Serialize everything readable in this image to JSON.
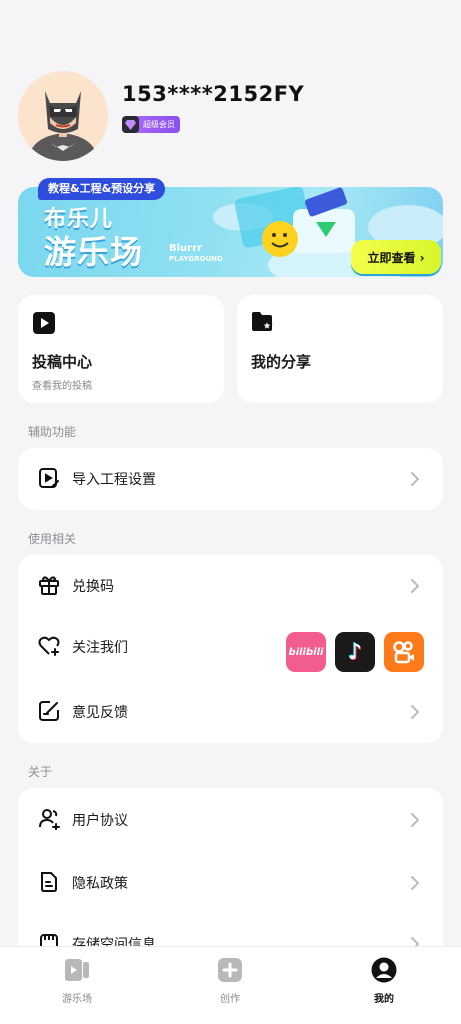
{
  "profile": {
    "username": "153****2152FY",
    "vip_label": "超级会员"
  },
  "banner": {
    "tag": "教程&工程&预设分享",
    "title_line1": "布乐儿",
    "title_line2": "游乐场",
    "brand_en": "Blurrr",
    "brand_sub": "PLAYGROUND",
    "cta": "立即查看 ›"
  },
  "tiles": {
    "submissions": {
      "title": "投稿中心",
      "subtitle": "查看我的投稿"
    },
    "shares": {
      "title": "我的分享"
    }
  },
  "sections": {
    "aux": "辅助功能",
    "usage": "使用相关",
    "about": "关于"
  },
  "aux_items": [
    {
      "label": "导入工程设置",
      "icon": "import-icon"
    }
  ],
  "usage_items": [
    {
      "label": "兑换码",
      "icon": "gift-icon"
    },
    {
      "label": "关注我们",
      "icon": "heart-icon"
    },
    {
      "label": "意见反馈",
      "icon": "feedback-icon"
    }
  ],
  "social": [
    {
      "name": "bilibili",
      "text": "bilibili",
      "color": "#f25d8e"
    },
    {
      "name": "tiktok",
      "text": "♪",
      "color": "#1a1a1a"
    },
    {
      "name": "kuaishou",
      "text": "",
      "color": "#ff7a1a"
    }
  ],
  "about_items": [
    {
      "label": "用户协议",
      "icon": "users-icon"
    },
    {
      "label": "隐私政策",
      "icon": "document-icon"
    },
    {
      "label": "存储空间信息",
      "icon": "storage-icon"
    }
  ],
  "bottom_nav": [
    {
      "label": "游乐场",
      "icon": "playground-icon",
      "active": false
    },
    {
      "label": "创作",
      "icon": "create-icon",
      "active": false
    },
    {
      "label": "我的",
      "icon": "profile-icon",
      "active": true
    }
  ],
  "colors": {
    "accent": "#2f4ddd",
    "vip": "#8a4ff0",
    "cta": "#e6fa35"
  }
}
